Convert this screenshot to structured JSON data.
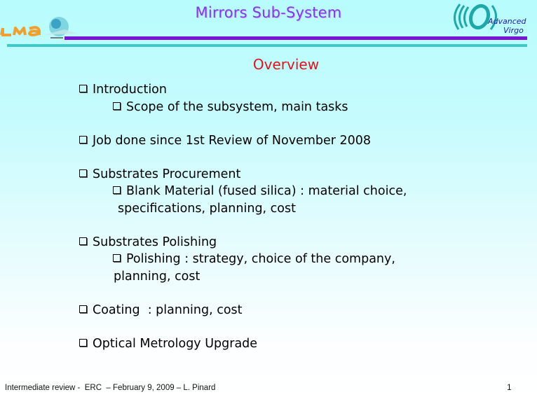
{
  "header": {
    "title": "Mirrors Sub-System",
    "logo_left": {
      "name": "LMA logo",
      "text": "LMA"
    },
    "logo_right": {
      "name": "Advanced Virgo logo",
      "line1": "Advanced",
      "line2": "Virgo"
    },
    "colors": {
      "title": "#7e3ce8",
      "bar_purple": "#7b12d8",
      "bar_teal": "#3ccbc9"
    }
  },
  "slide": {
    "subtitle": "Overview",
    "subtitle_color": "#e0141c",
    "bullet_icon": "hollow-square-bullet",
    "items": [
      {
        "text": "Introduction",
        "subitems": [
          {
            "lines": [
              "Scope of the subsystem, main tasks"
            ]
          }
        ]
      },
      {
        "text": "Job done since 1st Review of November 2008",
        "subitems": []
      },
      {
        "text": "Substrates Procurement",
        "subitems": [
          {
            "lines": [
              "Blank Material (fused silica) : material choice,",
              "specifications, planning, cost"
            ]
          }
        ]
      },
      {
        "text": "Substrates Polishing",
        "subitems": [
          {
            "lines": [
              "Polishing : strategy, choice of the company,",
              "planning, cost"
            ]
          }
        ]
      },
      {
        "text": "Coating  : planning, cost",
        "subitems": []
      },
      {
        "text": "Optical Metrology Upgrade",
        "subitems": []
      }
    ]
  },
  "footer": {
    "left": "Intermediate review -  ERC  – February 9, 2009 – L. Pinard",
    "page_number": "1"
  }
}
